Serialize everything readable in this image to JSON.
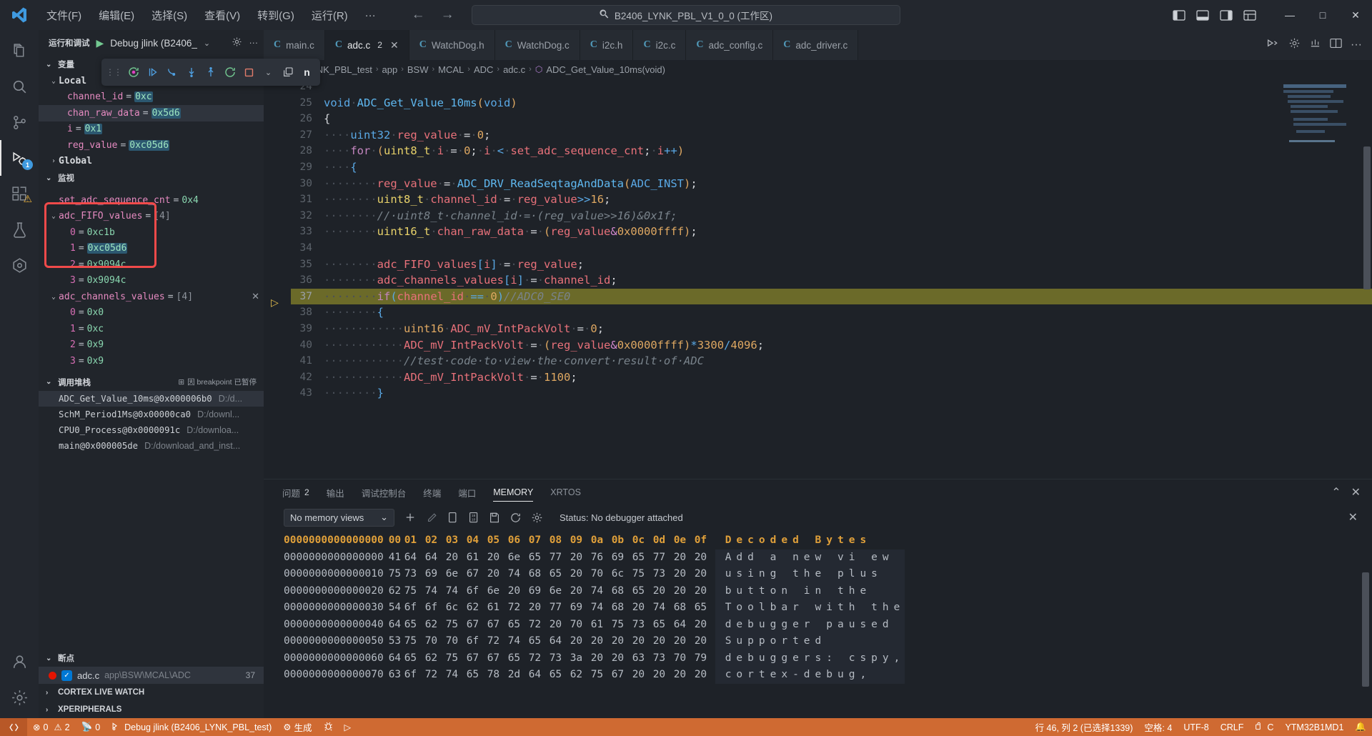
{
  "titlebar": {
    "menus": [
      "文件(F)",
      "编辑(E)",
      "选择(S)",
      "查看(V)",
      "转到(G)",
      "运行(R)",
      "···"
    ],
    "search_text": "B2406_LYNK_PBL_V1_0_0 (工作区)",
    "back_label": "←",
    "forward_label": "→",
    "minimize": "—",
    "maximize": "□",
    "close": "✕"
  },
  "sidebar": {
    "header": {
      "title": "运行和调试",
      "config": "Debug jlink (B2406_",
      "chevron": "⌄"
    },
    "sections": {
      "variables": "变量",
      "watch": "监视",
      "callstack": "调用堆栈",
      "callstack_status": "因 breakpoint 已暂停",
      "breakpoints": "断点",
      "cortex_live_watch": "CORTEX LIVE WATCH",
      "xperipherals": "XPERIPHERALS"
    },
    "variables": {
      "local_label": "Local",
      "global_label": "Global",
      "items": [
        {
          "name": "channel_id",
          "value": "0xc",
          "highlight": true
        },
        {
          "name": "chan_raw_data",
          "value": "0x5d6",
          "highlight": true
        },
        {
          "name": "i",
          "value": "0x1",
          "highlight": true
        },
        {
          "name": "reg_value",
          "value": "0xc05d6",
          "highlight": true
        }
      ]
    },
    "watch": {
      "scalar": {
        "name": "set_adc_sequence_cnt",
        "value": "0x4"
      },
      "arrays": [
        {
          "name": "adc_FIFO_values",
          "value": "[4]",
          "children": [
            {
              "name": "0",
              "value": "0xc1b",
              "highlight": false
            },
            {
              "name": "1",
              "value": "0xc05d6",
              "highlight": true
            },
            {
              "name": "2",
              "value": "0x9094c",
              "highlight": false
            },
            {
              "name": "3",
              "value": "0x9094c",
              "highlight": false
            }
          ]
        },
        {
          "name": "adc_channels_values",
          "value": "[4]",
          "boxed": true,
          "children": [
            {
              "name": "0",
              "value": "0x0",
              "highlight": false
            },
            {
              "name": "1",
              "value": "0xc",
              "highlight": false
            },
            {
              "name": "2",
              "value": "0x9",
              "highlight": false
            },
            {
              "name": "3",
              "value": "0x9",
              "highlight": false
            }
          ]
        }
      ]
    },
    "callstack": [
      {
        "fn": "ADC_Get_Value_10ms@0x000006b0",
        "path": "D:/d...",
        "selected": true
      },
      {
        "fn": "SchM_Period1Ms@0x00000ca0",
        "path": "D:/downl...",
        "selected": false
      },
      {
        "fn": "CPU0_Process@0x0000091c",
        "path": "D:/downloa...",
        "selected": false
      },
      {
        "fn": "main@0x000005de",
        "path": "D:/download_and_inst...",
        "selected": false
      }
    ],
    "breakpoints": [
      {
        "file": "adc.c",
        "path": "app\\BSW\\MCAL\\ADC",
        "line": "37",
        "checked": true
      }
    ]
  },
  "editor": {
    "tabs": [
      {
        "label": "main.c",
        "icon": "C",
        "active": false,
        "count": "",
        "closable": false
      },
      {
        "label": "adc.c",
        "icon": "C",
        "active": true,
        "count": "2",
        "closable": true
      },
      {
        "label": "WatchDog.h",
        "icon": "C",
        "active": false,
        "count": "",
        "closable": false
      },
      {
        "label": "WatchDog.c",
        "icon": "C",
        "active": false,
        "count": "",
        "closable": false
      },
      {
        "label": "i2c.h",
        "icon": "C",
        "active": false,
        "count": "",
        "closable": false
      },
      {
        "label": "i2c.c",
        "icon": "C",
        "active": false,
        "count": "",
        "closable": false
      },
      {
        "label": "adc_config.c",
        "icon": "C",
        "active": false,
        "count": "",
        "closable": false
      },
      {
        "label": "adc_driver.c",
        "icon": "C",
        "active": false,
        "count": "",
        "closable": false
      }
    ],
    "breadcrumb": [
      "B2406_LYNK_PBL_test",
      "app",
      "BSW",
      "MCAL",
      "ADC",
      "adc.c",
      "ADC_Get_Value_10ms(void)"
    ],
    "code_lines": [
      {
        "n": "24",
        "html": "",
        "hl": false
      },
      {
        "n": "25",
        "html": "<span class=\"kw2\">void</span><span class=\"ws\">·</span><span class=\"fn\">ADC_Get_Value_10ms</span><span class=\"num\">(</span><span class=\"kw2\">void</span><span class=\"num\">)</span>",
        "hl": false
      },
      {
        "n": "26",
        "html": "<span class=\"pun\">{</span>",
        "hl": false
      },
      {
        "n": "27",
        "html": "<span class=\"ws\">····</span><span class=\"kw2\">uint32</span><span class=\"ws\">·</span><span class=\"var\">reg_value</span><span class=\"ws\">·</span><span class=\"pun\">=</span><span class=\"ws\">·</span><span class=\"num\">0</span><span class=\"pun\">;</span>",
        "hl": false
      },
      {
        "n": "28",
        "html": "<span class=\"ws\">····</span><span class=\"kw\">for</span><span class=\"ws\">·</span><span class=\"num\">(</span><span class=\"typ\">uint8_t</span><span class=\"ws\">·</span><span class=\"var\">i</span><span class=\"ws\">·</span><span class=\"pun\">=</span><span class=\"ws\">·</span><span class=\"num\">0</span><span class=\"pun\">;</span><span class=\"ws\">·</span><span class=\"var\">i</span><span class=\"ws\">·</span><span class=\"kw2\">&lt;</span><span class=\"ws\">·</span><span class=\"var\">set_adc_sequence_cnt</span><span class=\"pun\">;</span><span class=\"ws\">·</span><span class=\"var\">i</span><span class=\"kw2\">++</span><span class=\"num\">)</span>",
        "hl": false
      },
      {
        "n": "29",
        "html": "<span class=\"ws\">····</span><span class=\"kw2\">{</span>",
        "hl": false
      },
      {
        "n": "30",
        "html": "<span class=\"ws\">········</span><span class=\"var\">reg_value</span><span class=\"ws\">·</span><span class=\"pun\">=</span><span class=\"ws\">·</span><span class=\"fn\">ADC_DRV_ReadSeqtagAndData</span><span class=\"num\">(</span><span class=\"kw2\">ADC_INST</span><span class=\"num\">)</span><span class=\"pun\">;</span>",
        "hl": false
      },
      {
        "n": "31",
        "html": "<span class=\"ws\">········</span><span class=\"typ\">uint8_t</span><span class=\"ws\">·</span><span class=\"var\">channel_id</span><span class=\"ws\">·</span><span class=\"pun\">=</span><span class=\"ws\">·</span><span class=\"var\">reg_value</span><span class=\"kw2\">&gt;&gt;</span><span class=\"num\">16</span><span class=\"pun\">;</span>",
        "hl": false
      },
      {
        "n": "32",
        "html": "<span class=\"ws\">········</span><span class=\"cmt\">//·uint8_t·channel_id·=·(reg_value&gt;&gt;16)&amp;0x1f;</span>",
        "hl": false
      },
      {
        "n": "33",
        "html": "<span class=\"ws\">········</span><span class=\"typ\">uint16_t</span><span class=\"ws\">·</span><span class=\"var\">chan_raw_data</span><span class=\"ws\">·</span><span class=\"pun\">=</span><span class=\"ws\">·</span><span class=\"num\">(</span><span class=\"var\">reg_value</span><span class=\"amp\">&amp;</span><span class=\"num\">0x0000ffff</span><span class=\"num\">)</span><span class=\"pun\">;</span>",
        "hl": false
      },
      {
        "n": "34",
        "html": "",
        "hl": false
      },
      {
        "n": "35",
        "html": "<span class=\"ws\">········</span><span class=\"var\">adc_FIFO_values</span><span class=\"kw2\">[</span><span class=\"var\">i</span><span class=\"kw2\">]</span><span class=\"ws\">·</span><span class=\"pun\">=</span><span class=\"ws\">·</span><span class=\"var\">reg_value</span><span class=\"pun\">;</span>",
        "hl": false
      },
      {
        "n": "36",
        "html": "<span class=\"ws\">········</span><span class=\"var\">adc_channels_values</span><span class=\"kw2\">[</span><span class=\"var\">i</span><span class=\"kw2\">]</span><span class=\"ws\">·</span><span class=\"pun\">=</span><span class=\"ws\">·</span><span class=\"var\">channel_id</span><span class=\"pun\">;</span>",
        "hl": false
      },
      {
        "n": "37",
        "html": "<span class=\"ws\">········</span><span class=\"kw\">if</span><span class=\"kw2\">(</span><span class=\"var\">channel_id</span><span class=\"ws\">·</span><span class=\"kw2\">==</span><span class=\"ws\">·</span><span class=\"num\">0</span><span class=\"kw2\">)</span><span class=\"cmt\">//ADC0_SE0</span>",
        "hl": true
      },
      {
        "n": "38",
        "html": "<span class=\"ws\">········</span><span class=\"kw2\">{</span>",
        "hl": false
      },
      {
        "n": "39",
        "html": "<span class=\"ws\">············</span><span class=\"num\">uint16</span><span class=\"ws\">·</span><span class=\"var\">ADC_mV_IntPackVolt</span><span class=\"ws\">·</span><span class=\"pun\">=</span><span class=\"ws\">·</span><span class=\"num\">0</span><span class=\"pun\">;</span>",
        "hl": false
      },
      {
        "n": "40",
        "html": "<span class=\"ws\">············</span><span class=\"var\">ADC_mV_IntPackVolt</span><span class=\"ws\">·</span><span class=\"pun\">=</span><span class=\"ws\">·</span><span class=\"num\">(</span><span class=\"var\">reg_value</span><span class=\"amp\">&amp;</span><span class=\"num\">0x0000ffff</span><span class=\"num\">)</span><span class=\"kw2\">*</span><span class=\"num\">3300</span><span class=\"kw2\">/</span><span class=\"num\">4096</span><span class=\"pun\">;</span>",
        "hl": false
      },
      {
        "n": "41",
        "html": "<span class=\"ws\">············</span><span class=\"cmt\">//test·code·to·view·the·convert·result·of·ADC</span>",
        "hl": false
      },
      {
        "n": "42",
        "html": "<span class=\"ws\">············</span><span class=\"var\">ADC_mV_IntPackVolt</span><span class=\"ws\">·</span><span class=\"pun\">=</span><span class=\"ws\">·</span><span class=\"num\">1100</span><span class=\"pun\">;</span>",
        "hl": false
      },
      {
        "n": "43",
        "html": "<span class=\"ws\">········</span><span class=\"kw2\">}</span>",
        "hl": false
      }
    ]
  },
  "panel": {
    "tabs": [
      {
        "label": "问题",
        "count": "2",
        "active": false
      },
      {
        "label": "输出",
        "count": "",
        "active": false
      },
      {
        "label": "调试控制台",
        "count": "",
        "active": false
      },
      {
        "label": "终端",
        "count": "",
        "active": false
      },
      {
        "label": "端口",
        "count": "",
        "active": false
      },
      {
        "label": "MEMORY",
        "count": "",
        "active": true
      },
      {
        "label": "XRTOS",
        "count": "",
        "active": false
      }
    ],
    "memory": {
      "view_select": "No memory views",
      "select_chevron": "⌄",
      "status": "Status: No debugger attached",
      "column_headers": [
        "00",
        "01",
        "02",
        "03",
        "04",
        "05",
        "06",
        "07",
        "08",
        "09",
        "0a",
        "0b",
        "0c",
        "0d",
        "0e",
        "0f"
      ],
      "addr_header": "0000000000000000",
      "decoded_header": "Decoded",
      "decoded_header2": "Bytes",
      "rows": [
        {
          "addr": "0000000000000000",
          "bytes": [
            "41",
            "64",
            "64",
            "20",
            "61",
            "20",
            "6e",
            "65",
            "77",
            "20",
            "76",
            "69",
            "65",
            "77",
            "20",
            "20"
          ],
          "ascii": "Add a new vi ew"
        },
        {
          "addr": "0000000000000010",
          "bytes": [
            "75",
            "73",
            "69",
            "6e",
            "67",
            "20",
            "74",
            "68",
            "65",
            "20",
            "70",
            "6c",
            "75",
            "73",
            "20",
            "20"
          ],
          "ascii": "using the plus"
        },
        {
          "addr": "0000000000000020",
          "bytes": [
            "62",
            "75",
            "74",
            "74",
            "6f",
            "6e",
            "20",
            "69",
            "6e",
            "20",
            "74",
            "68",
            "65",
            "20",
            "20",
            "20"
          ],
          "ascii": "button in the"
        },
        {
          "addr": "0000000000000030",
          "bytes": [
            "54",
            "6f",
            "6f",
            "6c",
            "62",
            "61",
            "72",
            "20",
            "77",
            "69",
            "74",
            "68",
            "20",
            "74",
            "68",
            "65"
          ],
          "ascii": "Toolbar with the"
        },
        {
          "addr": "0000000000000040",
          "bytes": [
            "64",
            "65",
            "62",
            "75",
            "67",
            "67",
            "65",
            "72",
            "20",
            "70",
            "61",
            "75",
            "73",
            "65",
            "64",
            "20"
          ],
          "ascii": "debugger paused"
        },
        {
          "addr": "0000000000000050",
          "bytes": [
            "53",
            "75",
            "70",
            "70",
            "6f",
            "72",
            "74",
            "65",
            "64",
            "20",
            "20",
            "20",
            "20",
            "20",
            "20",
            "20"
          ],
          "ascii": "Supported"
        },
        {
          "addr": "0000000000000060",
          "bytes": [
            "64",
            "65",
            "62",
            "75",
            "67",
            "67",
            "65",
            "72",
            "73",
            "3a",
            "20",
            "20",
            "63",
            "73",
            "70",
            "79"
          ],
          "ascii": "debuggers: cspy,"
        },
        {
          "addr": "0000000000000070",
          "bytes": [
            "63",
            "6f",
            "72",
            "74",
            "65",
            "78",
            "2d",
            "64",
            "65",
            "62",
            "75",
            "67",
            "20",
            "20",
            "20",
            "20"
          ],
          "ascii": "cortex-debug,"
        }
      ]
    }
  },
  "statusbar": {
    "errors": "0",
    "warnings": "2",
    "radio": "0",
    "debug_session": "Debug jlink (B2406_LYNK_PBL_test)",
    "build": "生成",
    "position": "行 46, 列 2 (已选择1339)",
    "spaces": "空格: 4",
    "encoding": "UTF-8",
    "eol": "CRLF",
    "language": "C",
    "device": "YTM32B1MD1"
  }
}
